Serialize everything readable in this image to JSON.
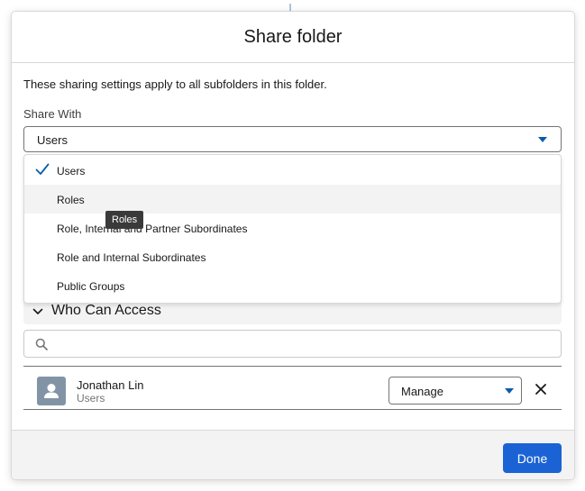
{
  "modal": {
    "title": "Share folder",
    "intro": "These sharing settings apply to all subfolders in this folder.",
    "share_with_label": "Share With"
  },
  "share_with": {
    "selected": "Users",
    "options": [
      {
        "label": "Users",
        "checked": true
      },
      {
        "label": "Roles",
        "hovered": true
      },
      {
        "label": "Role, Internal and Partner Subordinates"
      },
      {
        "label": "Role and Internal Subordinates"
      },
      {
        "label": "Public Groups"
      }
    ]
  },
  "tooltip": {
    "text": "Roles"
  },
  "who_can_access": {
    "title": "Who Can Access",
    "search_placeholder": "",
    "entries": [
      {
        "name": "Jonathan Lin",
        "type": "Users",
        "access": "Manage"
      }
    ]
  },
  "footer": {
    "done_label": "Done"
  },
  "colors": {
    "accent": "#0b5cab",
    "button": "#1b63d4",
    "hover_bg": "#f3f3f3",
    "avatar_bg": "#8293a6"
  },
  "icons": {
    "check": "check-icon",
    "chevron": "chevron-down-icon",
    "search": "search-icon",
    "avatar": "user-avatar-icon",
    "remove": "close-icon",
    "caret": "caret-down-icon"
  }
}
